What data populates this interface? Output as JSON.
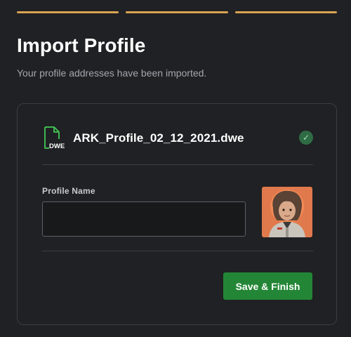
{
  "stepper": {
    "steps_total": 3,
    "steps_completed": 3,
    "accent": "#d8a452"
  },
  "header": {
    "title": "Import Profile",
    "subtitle": "Your profile addresses have been imported."
  },
  "file": {
    "name": "ARK_Profile_02_12_2021.dwe",
    "icon": "file-dwe-icon",
    "icon_text": "DWE",
    "status_icon": "check-circle-icon",
    "status": "imported"
  },
  "form": {
    "profile_name_label": "Profile Name",
    "profile_name_value": "",
    "avatar_icon": "profile-avatar"
  },
  "actions": {
    "save_label": "Save & Finish",
    "save_color": "#238636"
  },
  "colors": {
    "background": "#202124",
    "border": "#3a3d42",
    "success": "#2f6b44",
    "file_icon": "#3fb950"
  }
}
